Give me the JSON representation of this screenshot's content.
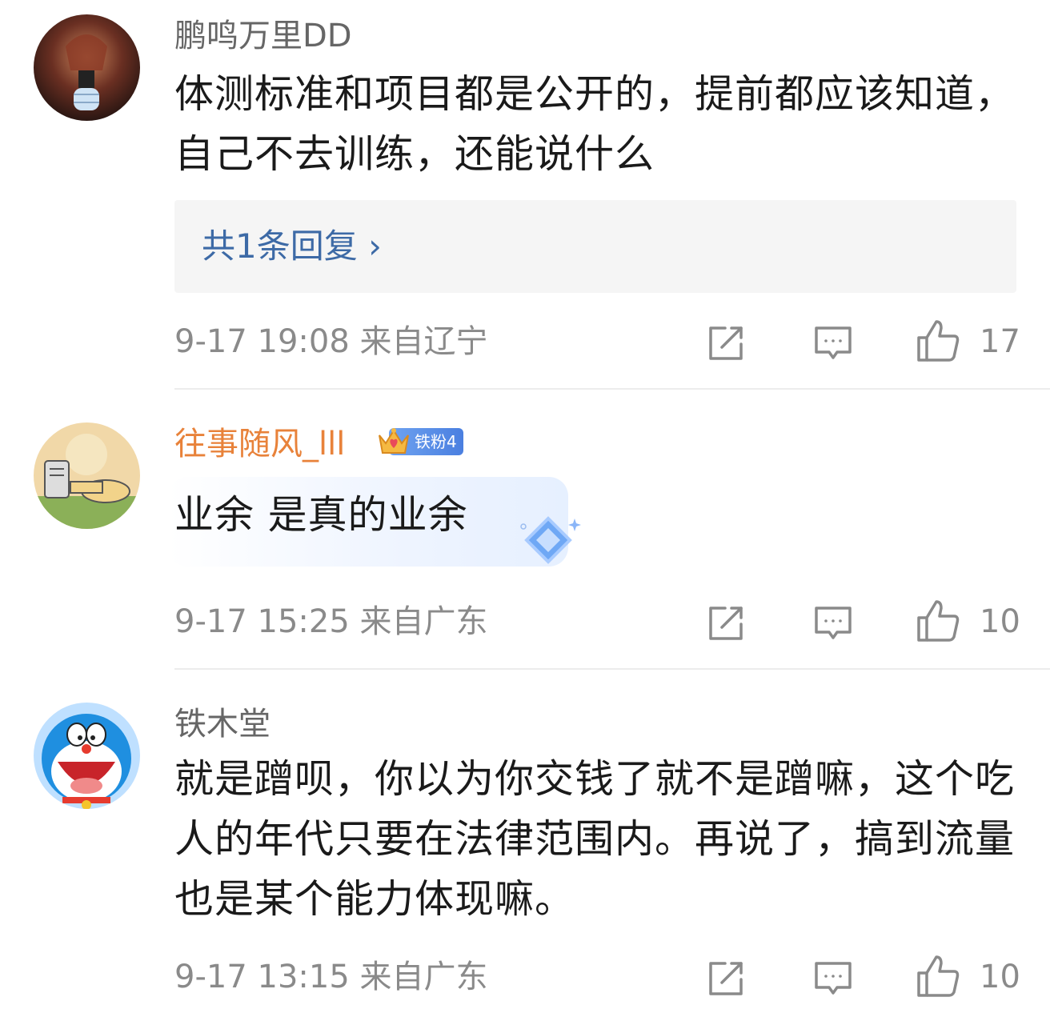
{
  "comments": [
    {
      "username": "鹏鸣万里DD",
      "text": "体测标准和项目都是公开的，提前都应该知道，自己不去训练，还能说什么",
      "reply_link": "共1条回复 ›",
      "time": "9-17 19:08",
      "location": "来自辽宁",
      "likes": "17"
    },
    {
      "username": "往事随风_lll",
      "badge": "铁粉4",
      "text": "业余 是真的业余",
      "time": "9-17 15:25",
      "location": "来自广东",
      "likes": "10"
    },
    {
      "username": "铁木堂",
      "text": "就是蹭呗，你以为你交钱了就不是蹭嘛，这个吃人的年代只要在法律范围内。再说了，搞到流量也是某个能力体现嘛。",
      "time": "9-17 13:15",
      "location": "来自广东",
      "likes": "10"
    }
  ],
  "colors": {
    "username_gray": "#666666",
    "username_orange": "#e8823a",
    "reply_blue": "#3d6aa6",
    "meta_gray": "#8a8a8a"
  },
  "icons": [
    "repost-icon",
    "comment-icon",
    "like-icon"
  ]
}
